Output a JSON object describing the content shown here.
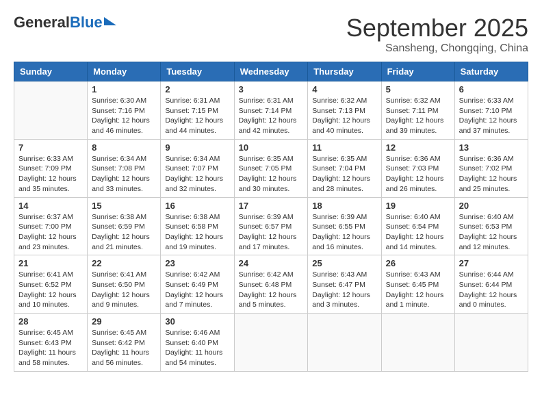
{
  "logo": {
    "general": "General",
    "blue": "Blue"
  },
  "title": "September 2025",
  "subtitle": "Sansheng, Chongqing, China",
  "headers": [
    "Sunday",
    "Monday",
    "Tuesday",
    "Wednesday",
    "Thursday",
    "Friday",
    "Saturday"
  ],
  "weeks": [
    [
      {
        "day": "",
        "info": ""
      },
      {
        "day": "1",
        "info": "Sunrise: 6:30 AM\nSunset: 7:16 PM\nDaylight: 12 hours\nand 46 minutes."
      },
      {
        "day": "2",
        "info": "Sunrise: 6:31 AM\nSunset: 7:15 PM\nDaylight: 12 hours\nand 44 minutes."
      },
      {
        "day": "3",
        "info": "Sunrise: 6:31 AM\nSunset: 7:14 PM\nDaylight: 12 hours\nand 42 minutes."
      },
      {
        "day": "4",
        "info": "Sunrise: 6:32 AM\nSunset: 7:13 PM\nDaylight: 12 hours\nand 40 minutes."
      },
      {
        "day": "5",
        "info": "Sunrise: 6:32 AM\nSunset: 7:11 PM\nDaylight: 12 hours\nand 39 minutes."
      },
      {
        "day": "6",
        "info": "Sunrise: 6:33 AM\nSunset: 7:10 PM\nDaylight: 12 hours\nand 37 minutes."
      }
    ],
    [
      {
        "day": "7",
        "info": "Sunrise: 6:33 AM\nSunset: 7:09 PM\nDaylight: 12 hours\nand 35 minutes."
      },
      {
        "day": "8",
        "info": "Sunrise: 6:34 AM\nSunset: 7:08 PM\nDaylight: 12 hours\nand 33 minutes."
      },
      {
        "day": "9",
        "info": "Sunrise: 6:34 AM\nSunset: 7:07 PM\nDaylight: 12 hours\nand 32 minutes."
      },
      {
        "day": "10",
        "info": "Sunrise: 6:35 AM\nSunset: 7:05 PM\nDaylight: 12 hours\nand 30 minutes."
      },
      {
        "day": "11",
        "info": "Sunrise: 6:35 AM\nSunset: 7:04 PM\nDaylight: 12 hours\nand 28 minutes."
      },
      {
        "day": "12",
        "info": "Sunrise: 6:36 AM\nSunset: 7:03 PM\nDaylight: 12 hours\nand 26 minutes."
      },
      {
        "day": "13",
        "info": "Sunrise: 6:36 AM\nSunset: 7:02 PM\nDaylight: 12 hours\nand 25 minutes."
      }
    ],
    [
      {
        "day": "14",
        "info": "Sunrise: 6:37 AM\nSunset: 7:00 PM\nDaylight: 12 hours\nand 23 minutes."
      },
      {
        "day": "15",
        "info": "Sunrise: 6:38 AM\nSunset: 6:59 PM\nDaylight: 12 hours\nand 21 minutes."
      },
      {
        "day": "16",
        "info": "Sunrise: 6:38 AM\nSunset: 6:58 PM\nDaylight: 12 hours\nand 19 minutes."
      },
      {
        "day": "17",
        "info": "Sunrise: 6:39 AM\nSunset: 6:57 PM\nDaylight: 12 hours\nand 17 minutes."
      },
      {
        "day": "18",
        "info": "Sunrise: 6:39 AM\nSunset: 6:55 PM\nDaylight: 12 hours\nand 16 minutes."
      },
      {
        "day": "19",
        "info": "Sunrise: 6:40 AM\nSunset: 6:54 PM\nDaylight: 12 hours\nand 14 minutes."
      },
      {
        "day": "20",
        "info": "Sunrise: 6:40 AM\nSunset: 6:53 PM\nDaylight: 12 hours\nand 12 minutes."
      }
    ],
    [
      {
        "day": "21",
        "info": "Sunrise: 6:41 AM\nSunset: 6:52 PM\nDaylight: 12 hours\nand 10 minutes."
      },
      {
        "day": "22",
        "info": "Sunrise: 6:41 AM\nSunset: 6:50 PM\nDaylight: 12 hours\nand 9 minutes."
      },
      {
        "day": "23",
        "info": "Sunrise: 6:42 AM\nSunset: 6:49 PM\nDaylight: 12 hours\nand 7 minutes."
      },
      {
        "day": "24",
        "info": "Sunrise: 6:42 AM\nSunset: 6:48 PM\nDaylight: 12 hours\nand 5 minutes."
      },
      {
        "day": "25",
        "info": "Sunrise: 6:43 AM\nSunset: 6:47 PM\nDaylight: 12 hours\nand 3 minutes."
      },
      {
        "day": "26",
        "info": "Sunrise: 6:43 AM\nSunset: 6:45 PM\nDaylight: 12 hours\nand 1 minute."
      },
      {
        "day": "27",
        "info": "Sunrise: 6:44 AM\nSunset: 6:44 PM\nDaylight: 12 hours\nand 0 minutes."
      }
    ],
    [
      {
        "day": "28",
        "info": "Sunrise: 6:45 AM\nSunset: 6:43 PM\nDaylight: 11 hours\nand 58 minutes."
      },
      {
        "day": "29",
        "info": "Sunrise: 6:45 AM\nSunset: 6:42 PM\nDaylight: 11 hours\nand 56 minutes."
      },
      {
        "day": "30",
        "info": "Sunrise: 6:46 AM\nSunset: 6:40 PM\nDaylight: 11 hours\nand 54 minutes."
      },
      {
        "day": "",
        "info": ""
      },
      {
        "day": "",
        "info": ""
      },
      {
        "day": "",
        "info": ""
      },
      {
        "day": "",
        "info": ""
      }
    ]
  ]
}
